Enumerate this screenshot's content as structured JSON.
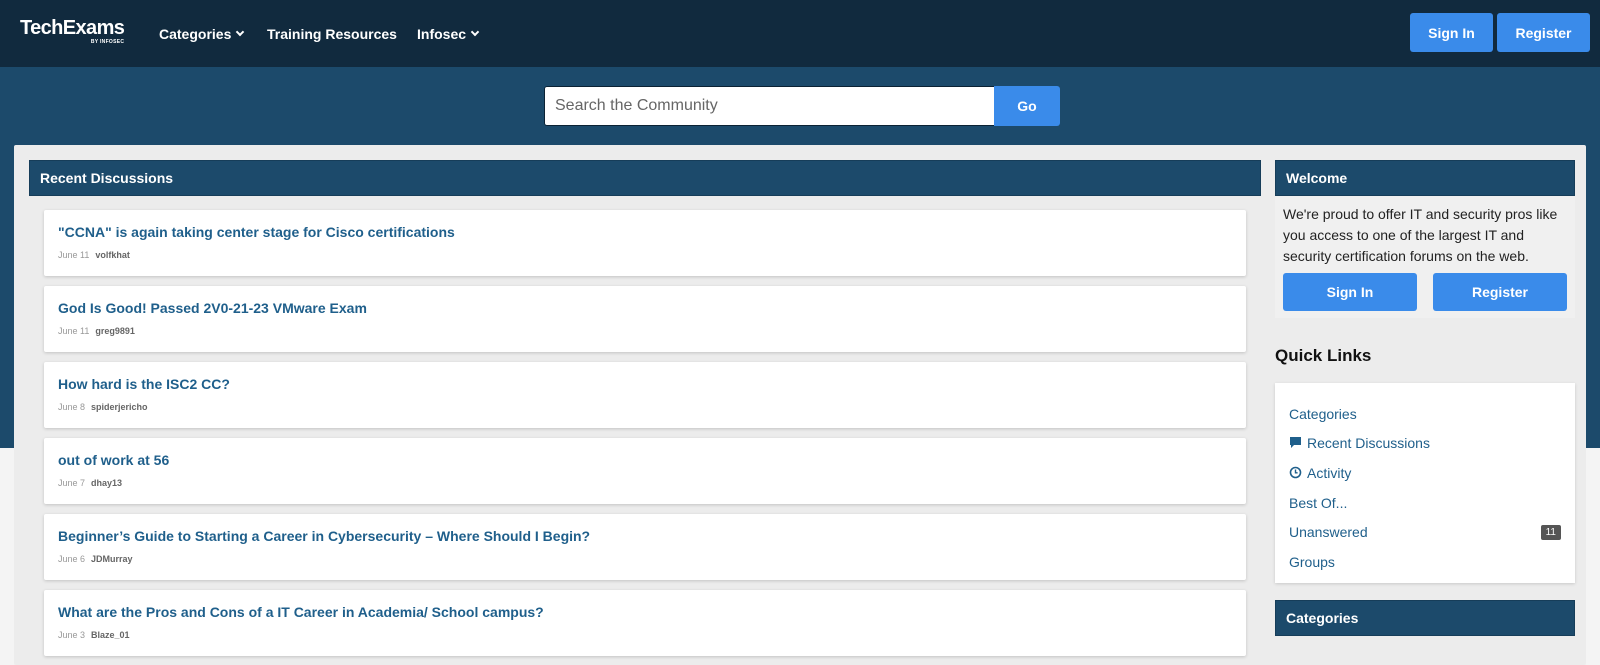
{
  "header": {
    "logo_main": "TechExams",
    "logo_sub": "BY INFOSEC",
    "nav": [
      {
        "label": "Categories",
        "dropdown": true
      },
      {
        "label": "Training Resources",
        "dropdown": false
      },
      {
        "label": "Infosec",
        "dropdown": true
      }
    ],
    "sign_in": "Sign In",
    "register": "Register"
  },
  "search": {
    "placeholder": "Search the Community",
    "go_label": "Go"
  },
  "recent": {
    "title": "Recent Discussions",
    "items": [
      {
        "title": "\"CCNA\" is again taking center stage for Cisco certifications",
        "date": "June 11",
        "author": "volfkhat"
      },
      {
        "title": "God Is Good! Passed 2V0-21-23 VMware Exam",
        "date": "June 11",
        "author": "greg9891"
      },
      {
        "title": "How hard is the ISC2 CC?",
        "date": "June 8",
        "author": "spiderjericho"
      },
      {
        "title": "out of work at 56",
        "date": "June 7",
        "author": "dhay13"
      },
      {
        "title": "Beginner’s Guide to Starting a Career in Cybersecurity – Where Should I Begin?",
        "date": "June 6",
        "author": "JDMurray"
      },
      {
        "title": "What are the Pros and Cons of a IT Career in Academia/ School campus?",
        "date": "June 3",
        "author": "Blaze_01"
      }
    ]
  },
  "welcome": {
    "title": "Welcome",
    "text": "We're proud to offer IT and security pros like you access to one of the largest IT and security certification forums on the web.",
    "sign_in": "Sign In",
    "register": "Register"
  },
  "quick_links": {
    "title": "Quick Links",
    "items": [
      {
        "label": "Categories",
        "icon": ""
      },
      {
        "label": "Recent Discussions",
        "icon": "comment-icon"
      },
      {
        "label": "Activity",
        "icon": "clock-icon"
      },
      {
        "label": "Best Of...",
        "icon": ""
      },
      {
        "label": "Unanswered",
        "icon": "",
        "badge": "11"
      },
      {
        "label": "Groups",
        "icon": ""
      }
    ]
  },
  "categories_panel": {
    "title": "Categories"
  },
  "colors": {
    "topbar": "#112a3e",
    "band": "#1c4a6b",
    "button": "#3a8bea",
    "link": "#1f5f8b"
  }
}
